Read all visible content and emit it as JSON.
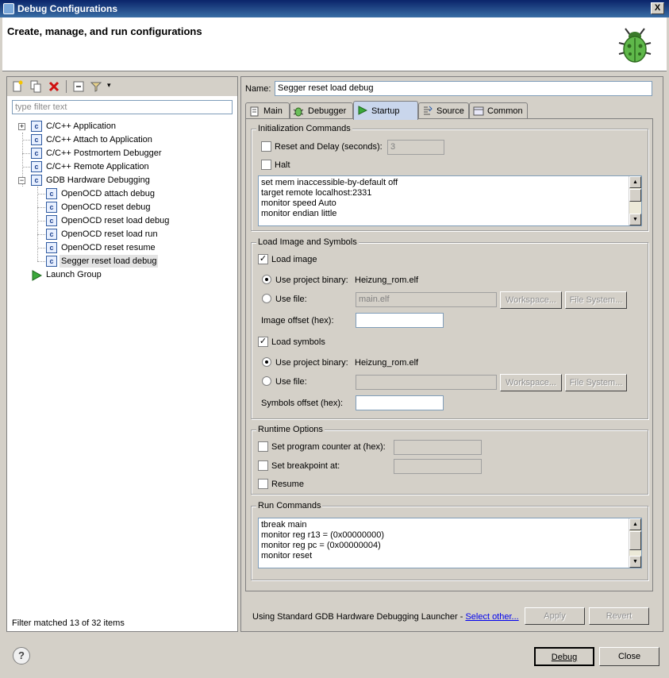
{
  "window": {
    "title": "Debug Configurations",
    "close": "X"
  },
  "banner": {
    "title": "Create, manage, and run configurations"
  },
  "left": {
    "filter_placeholder": "type filter text",
    "tree": [
      {
        "label": "C/C++ Application"
      },
      {
        "label": "C/C++ Attach to Application"
      },
      {
        "label": "C/C++ Postmortem Debugger"
      },
      {
        "label": "C/C++ Remote Application"
      },
      {
        "label": "GDB Hardware Debugging"
      },
      {
        "label": "OpenOCD attach debug"
      },
      {
        "label": "OpenOCD reset debug"
      },
      {
        "label": "OpenOCD reset load debug"
      },
      {
        "label": "OpenOCD reset load run"
      },
      {
        "label": "OpenOCD reset resume"
      },
      {
        "label": "Segger reset load debug"
      },
      {
        "label": "Launch Group"
      }
    ],
    "status": "Filter matched 13 of 32 items"
  },
  "right": {
    "name_label": "Name:",
    "name_value": "Segger reset load debug",
    "tabs": [
      "Main",
      "Debugger",
      "Startup",
      "Source",
      "Common"
    ],
    "init": {
      "title": "Initialization Commands",
      "reset_label": "Reset and Delay (seconds):",
      "reset_value": "3",
      "halt_label": "Halt",
      "commands": [
        "set mem inaccessible-by-default off",
        "target remote localhost:2331",
        "monitor speed Auto",
        "monitor endian little"
      ]
    },
    "load": {
      "title": "Load Image and Symbols",
      "load_image": "Load image",
      "use_project_binary": "Use project binary:",
      "project_binary_value": "Heizung_rom.elf",
      "use_file": "Use file:",
      "image_file_value": "main.elf",
      "workspace": "Workspace...",
      "file_system": "File System...",
      "image_offset": "Image offset (hex):",
      "load_symbols": "Load symbols",
      "symbols_offset": "Symbols offset (hex):"
    },
    "runtime": {
      "title": "Runtime Options",
      "set_pc": "Set program counter at (hex):",
      "set_bp": "Set breakpoint at:",
      "resume": "Resume"
    },
    "run": {
      "title": "Run Commands",
      "commands": [
        "tbreak main",
        "monitor reg r13 = (0x00000000)",
        "monitor reg pc = (0x00000004)",
        "monitor reset"
      ]
    },
    "launcher_text": "Using Standard GDB Hardware Debugging Launcher - ",
    "launcher_link": "Select other...",
    "apply": "Apply",
    "revert": "Revert"
  },
  "footer": {
    "help": "?",
    "debug": "Debug",
    "close": "Close"
  }
}
